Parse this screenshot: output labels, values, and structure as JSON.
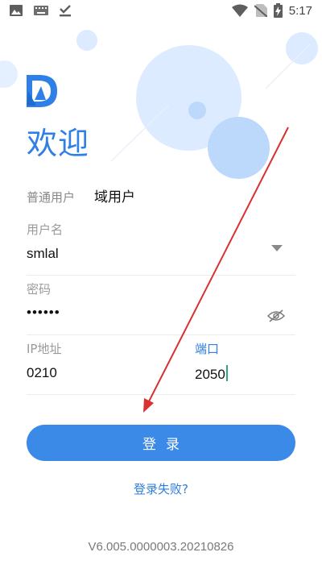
{
  "status_bar": {
    "time": "5:17",
    "left_icons": [
      "image-icon",
      "keyboard-icon",
      "download-done-icon"
    ],
    "right_icons": [
      "wifi-icon",
      "no-sim-icon",
      "battery-charging-icon"
    ]
  },
  "app": {
    "welcome_title": "欢迎",
    "logo_icon": "app-logo-icon"
  },
  "login_tabs": {
    "normal_user": "普通用户",
    "domain_user": "域用户"
  },
  "form": {
    "username_label": "用户名",
    "username_value": "smlal",
    "password_label": "密码",
    "password_value": "••••••",
    "ip_label": "IP地址",
    "ip_value": "0210",
    "port_label": "端口",
    "port_value": "2050"
  },
  "actions": {
    "login_label": "登录",
    "login_failed_link": "登录失败?"
  },
  "footer": {
    "version": "V6.005.0000003.20210826"
  },
  "colors": {
    "accent": "#3b8ae8",
    "link": "#2f7de0",
    "deco_circle": "#dcebff",
    "annotation_arrow": "#d93030"
  }
}
